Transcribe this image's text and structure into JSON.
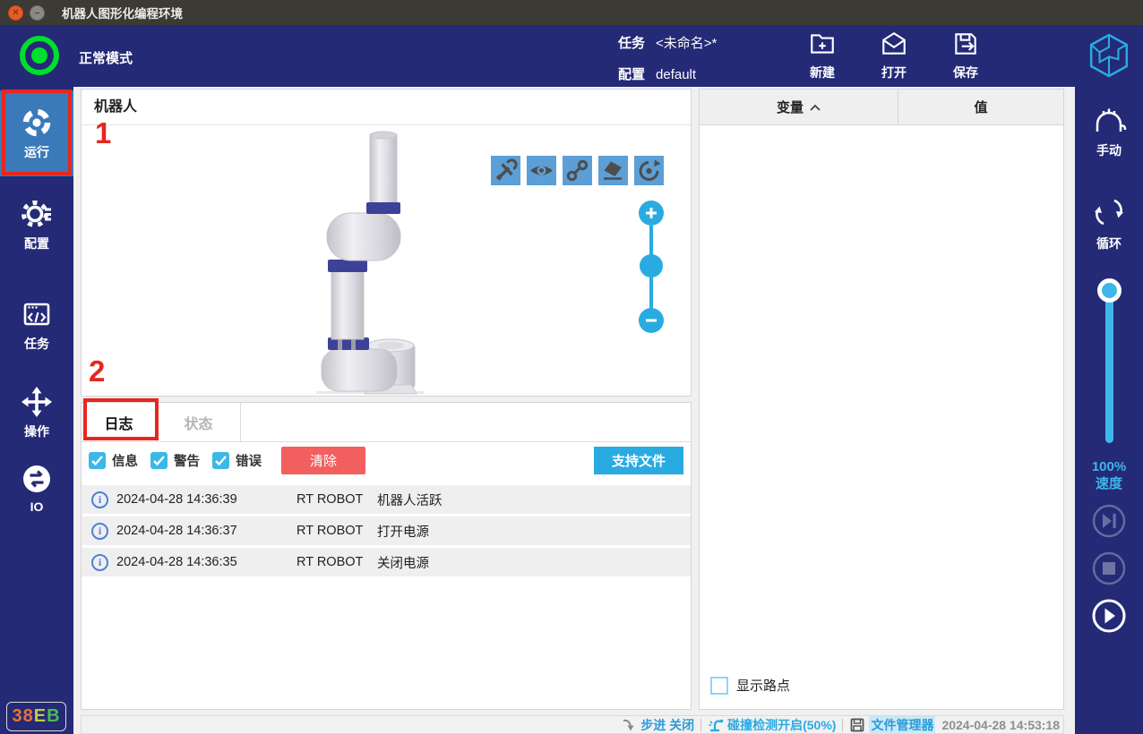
{
  "colors": {
    "navy": "#242A76",
    "active_item_blue": "#3A7AB8",
    "accent_cyan": "#29ABE2",
    "annotation_red": "#E8251F",
    "clear_button_red": "#F25F5F",
    "toolbar_button_blue": "#5C9FD6",
    "status_green": "#00DF2B",
    "info_icon_blue": "#4C7FD9"
  },
  "window": {
    "title": "机器人图形化编程环境",
    "close_glyph": "✕",
    "minimize_glyph": "–"
  },
  "header": {
    "mode_label": "正常模式",
    "task_label": "任务",
    "task_value": "<未命名>*",
    "config_label": "配置",
    "config_value": "default",
    "actions": [
      {
        "label": "新建"
      },
      {
        "label": "打开"
      },
      {
        "label": "保存"
      }
    ]
  },
  "sidebar": {
    "items": [
      {
        "label": "运行",
        "active": true
      },
      {
        "label": "配置",
        "active": false
      },
      {
        "label": "任务",
        "active": false
      },
      {
        "label": "操作",
        "active": false
      },
      {
        "label": "IO",
        "active": false
      }
    ],
    "badge_parts": [
      {
        "text": "38",
        "color": "#E8742F"
      },
      {
        "text": "E",
        "color": "#BFCC3A"
      },
      {
        "text": "B",
        "color": "#49BE50"
      }
    ]
  },
  "annotations": {
    "step1": "1",
    "step2": "2"
  },
  "robot_panel": {
    "title": "机器人"
  },
  "log_panel": {
    "tabs": [
      {
        "label": "日志",
        "active": true
      },
      {
        "label": "状态",
        "active": false
      }
    ],
    "filters": [
      {
        "label": "信息",
        "checked": true
      },
      {
        "label": "警告",
        "checked": true
      },
      {
        "label": "错误",
        "checked": true
      }
    ],
    "clear_button": "清除",
    "support_file_button": "支持文件",
    "entries": [
      {
        "time": "2024-04-28 14:36:39",
        "source": "RT ROBOT",
        "message": "机器人活跃"
      },
      {
        "time": "2024-04-28 14:36:37",
        "source": "RT ROBOT",
        "message": "打开电源"
      },
      {
        "time": "2024-04-28 14:36:35",
        "source": "RT ROBOT",
        "message": "关闭电源"
      }
    ]
  },
  "variables_panel": {
    "col_variable": "变量",
    "sort": "asc",
    "col_value": "值",
    "rows": [],
    "show_waypoints_label": "显示路点",
    "show_waypoints_checked": false
  },
  "right_sidebar": {
    "manual_label": "手动",
    "loop_label": "循环",
    "speed_value": "100%",
    "speed_label": "速度"
  },
  "status_bar": {
    "step_label": "步进 关闭",
    "collision_label": "碰撞检测开启(50%)",
    "file_manager_label": "文件管理器",
    "timestamp": "2024-04-28 14:53:18"
  }
}
